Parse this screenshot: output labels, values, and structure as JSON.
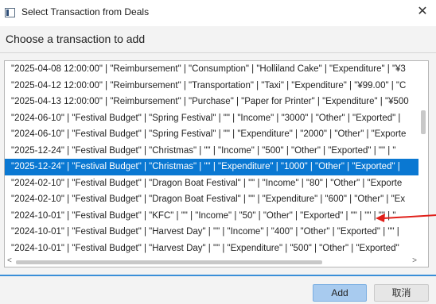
{
  "window": {
    "title": "Select Transaction from Deals",
    "close_glyph": "✕"
  },
  "header": {
    "prompt": "Choose a transaction to add"
  },
  "list": {
    "selected_index": 6,
    "items": [
      "\"2025-04-08 12:00:00\" | \"Reimbursement\" | \"Consumption\" | \"Holliland Cake\" | \"Expenditure\" | \"¥3",
      "\"2025-04-12 12:00:00\" | \"Reimbursement\" | \"Transportation\" | \"Taxi\" | \"Expenditure\" | \"¥99.00\" | \"C",
      "\"2025-04-13 12:00:00\" | \"Reimbursement\" | \"Purchase\" | \"Paper for Printer\" | \"Expenditure\" | \"¥500",
      "\"2024-06-10\" | \"Festival Budget\" | \"Spring Festival\" | \"\" | \"Income\" | \"3000\" | \"Other\" | \"Exported\" |",
      "\"2024-06-10\" | \"Festival Budget\" | \"Spring Festival\" | \"\" | \"Expenditure\" | \"2000\" | \"Other\" | \"Exporte",
      "\"2025-12-24\" | \"Festival Budget\" | \"Christmas\" | \"\" | \"Income\" | \"500\" | \"Other\" | \"Exported\" | \"\" | \"",
      "\"2025-12-24\" | \"Festival Budget\" | \"Christmas\" | \"\" | \"Expenditure\" | \"1000\" | \"Other\" | \"Exported\" |",
      "\"2024-02-10\" | \"Festival Budget\" | \"Dragon Boat Festival\" | \"\" | \"Income\" | \"80\" | \"Other\" | \"Exporte",
      "\"2024-02-10\" | \"Festival Budget\" | \"Dragon Boat Festival\" | \"\" | \"Expenditure\" | \"600\" | \"Other\" | \"Ex",
      "\"2024-10-01\" | \"Festival Budget\" | \"KFC\" | \"\" | \"Income\" | \"50\" | \"Other\" | \"Exported\" | \"\" | \"\" | \"\" | \"",
      "\"2024-10-01\" | \"Festival Budget\" | \"Harvest Day\" | \"\" | \"Income\" | \"400\" | \"Other\" | \"Exported\" | \"\" |",
      "\"2024-10-01\" | \"Festival Budget\" | \"Harvest Day\" | \"\" | \"Expenditure\" | \"500\" | \"Other\" | \"Exported\""
    ]
  },
  "scrollbar": {
    "left_arrow": "<",
    "right_arrow": ">"
  },
  "buttons": {
    "add": "Add",
    "cancel": "取消"
  },
  "colors": {
    "selection": "#0a78d2",
    "add_button": "#a8cbef",
    "annotation_arrow": "#e0201a",
    "footer_border": "#3a8fd8"
  }
}
